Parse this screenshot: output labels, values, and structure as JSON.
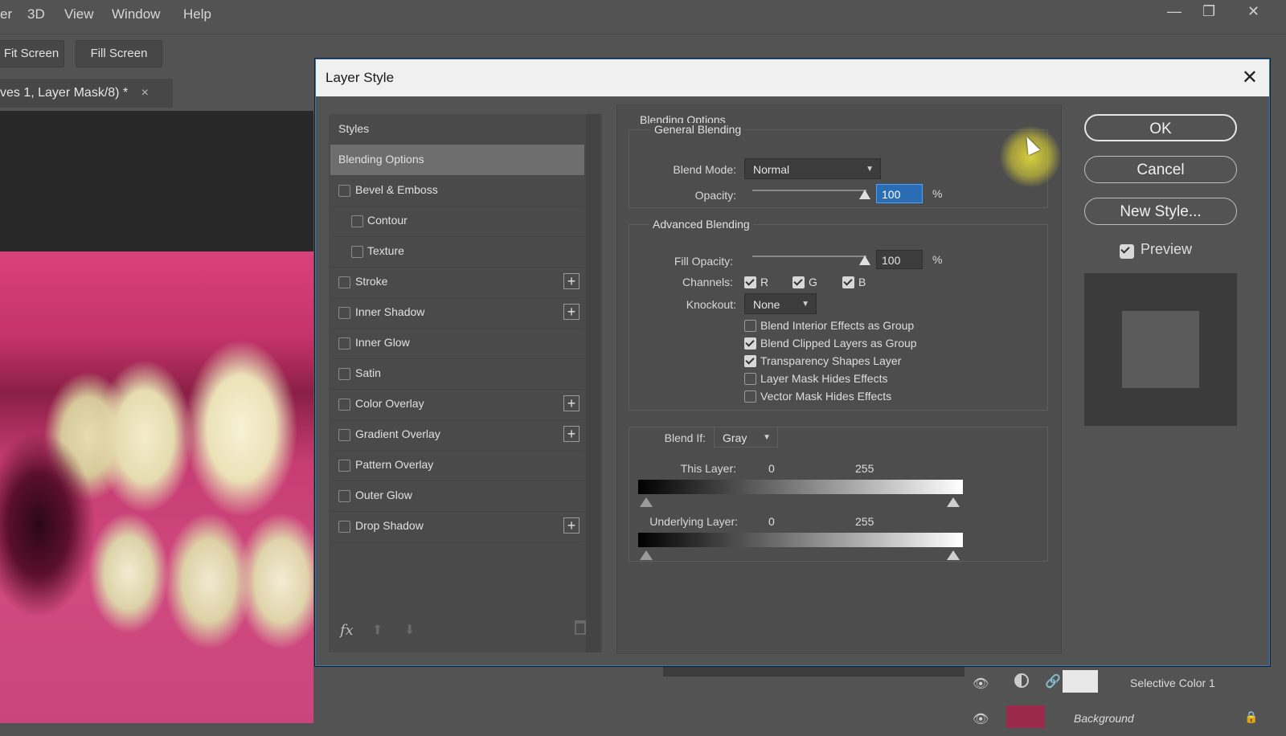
{
  "app": {
    "menu": [
      "er",
      "3D",
      "View",
      "Window",
      "Help"
    ],
    "toolbar": {
      "fit_screen": "Fit Screen",
      "fill_screen": "Fill Screen"
    },
    "doc_tab": "ves 1, Layer Mask/8) *",
    "doc_tab_close": "×",
    "layers": [
      {
        "name": "Selective Color 1"
      },
      {
        "name": "Background"
      }
    ]
  },
  "dialog": {
    "title": "Layer Style",
    "close": "✕",
    "styles_panel": {
      "header": "Styles",
      "items": [
        {
          "label": "Blending Options",
          "selected": true,
          "checkbox": false,
          "plus": false,
          "indent": false
        },
        {
          "label": "Bevel & Emboss",
          "checkbox": true,
          "plus": false,
          "indent": false
        },
        {
          "label": "Contour",
          "checkbox": true,
          "plus": false,
          "indent": true
        },
        {
          "label": "Texture",
          "checkbox": true,
          "plus": false,
          "indent": true
        },
        {
          "label": "Stroke",
          "checkbox": true,
          "plus": true,
          "indent": false
        },
        {
          "label": "Inner Shadow",
          "checkbox": true,
          "plus": true,
          "indent": false
        },
        {
          "label": "Inner Glow",
          "checkbox": true,
          "plus": false,
          "indent": false
        },
        {
          "label": "Satin",
          "checkbox": true,
          "plus": false,
          "indent": false
        },
        {
          "label": "Color Overlay",
          "checkbox": true,
          "plus": true,
          "indent": false
        },
        {
          "label": "Gradient Overlay",
          "checkbox": true,
          "plus": true,
          "indent": false
        },
        {
          "label": "Pattern Overlay",
          "checkbox": true,
          "plus": false,
          "indent": false
        },
        {
          "label": "Outer Glow",
          "checkbox": true,
          "plus": false,
          "indent": false
        },
        {
          "label": "Drop Shadow",
          "checkbox": true,
          "plus": true,
          "indent": false
        }
      ],
      "fx": "fx"
    },
    "options": {
      "section_title": "Blending Options",
      "general_title": "General Blending",
      "blend_mode_label": "Blend Mode:",
      "blend_mode_value": "Normal",
      "opacity_label": "Opacity:",
      "opacity_value": "100",
      "percent": "%",
      "advanced_title": "Advanced Blending",
      "fill_opacity_label": "Fill Opacity:",
      "fill_opacity_value": "100",
      "channels_label": "Channels:",
      "channels": [
        {
          "label": "R",
          "checked": true
        },
        {
          "label": "G",
          "checked": true
        },
        {
          "label": "B",
          "checked": true
        }
      ],
      "knockout_label": "Knockout:",
      "knockout_value": "None",
      "checks": [
        {
          "label": "Blend Interior Effects as Group",
          "checked": false
        },
        {
          "label": "Blend Clipped Layers as Group",
          "checked": true
        },
        {
          "label": "Transparency Shapes Layer",
          "checked": true
        },
        {
          "label": "Layer Mask Hides Effects",
          "checked": false
        },
        {
          "label": "Vector Mask Hides Effects",
          "checked": false
        }
      ],
      "blend_if_label": "Blend If:",
      "blend_if_value": "Gray",
      "this_layer_label": "This Layer:",
      "this_layer_min": "0",
      "this_layer_max": "255",
      "underlying_label": "Underlying Layer:",
      "underlying_min": "0",
      "underlying_max": "255"
    },
    "buttons": {
      "ok": "OK",
      "cancel": "Cancel",
      "new_style": "New Style..."
    },
    "preview": {
      "label": "Preview",
      "checked": true
    }
  },
  "colors": {
    "accent": "#2f7cc4",
    "highlight": "#2a6db5",
    "cursor_glow": "#e6dc32"
  }
}
